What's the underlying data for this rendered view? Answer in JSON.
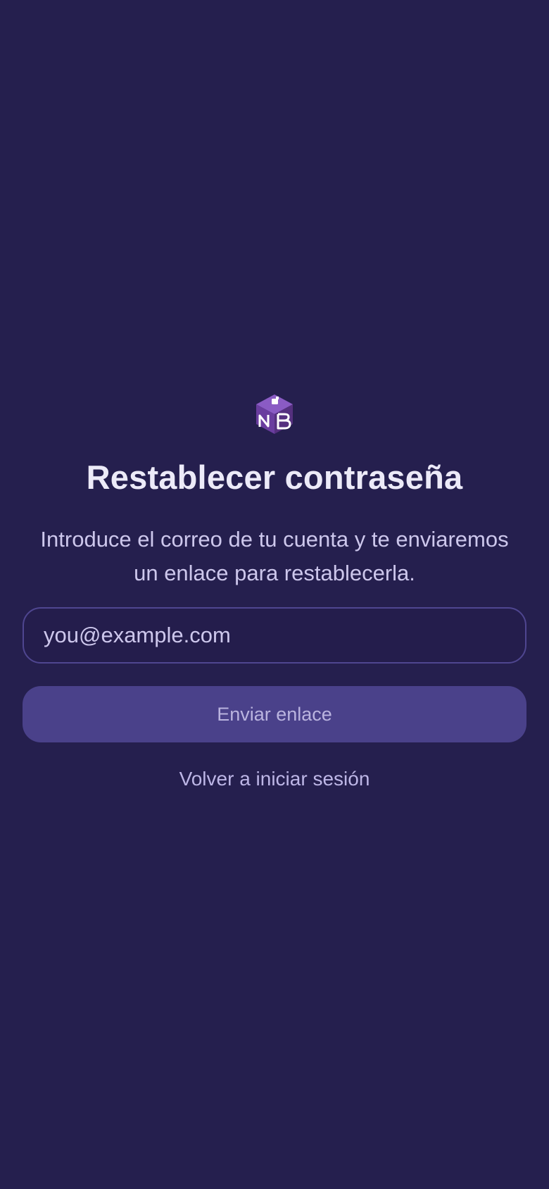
{
  "app": {
    "logo_icon": "nb-cube-logo-icon",
    "logo_text": "NB"
  },
  "reset": {
    "title": "Restablecer contraseña",
    "description": "Introduce el correo de tu cuenta y te enviaremos un enlace para restablecerla.",
    "email_placeholder": "you@example.com",
    "email_value": "",
    "submit_label": "Enviar enlace",
    "back_link_label": "Volver a iniciar sesión"
  },
  "colors": {
    "background": "#251f4e",
    "button_background": "#4a418a",
    "input_border": "#4f4690",
    "title_text": "#eceaf8",
    "muted_text": "#cdc7ec",
    "logo_purple": "#6d3fa6"
  }
}
